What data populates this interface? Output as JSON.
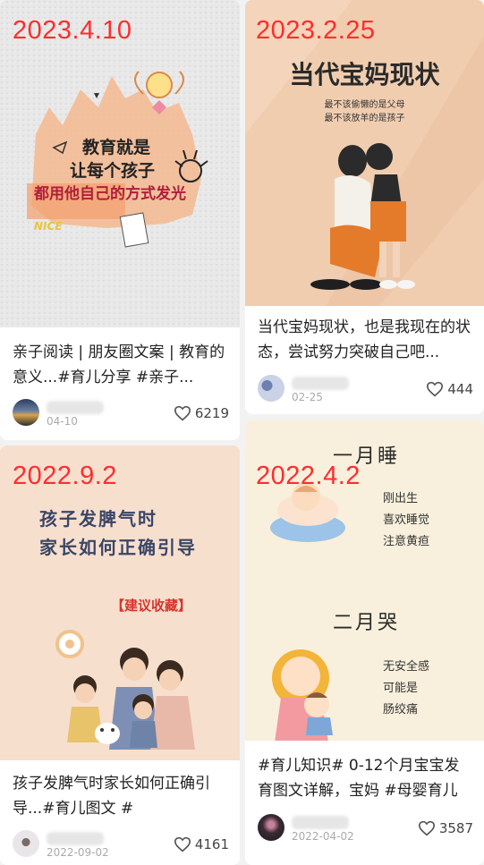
{
  "cards": [
    {
      "stamp": "2023.4.10",
      "title": "亲子阅读 | 朋友圈文案 | 教育的意义...#育儿分享 #亲子...",
      "date": "04-10",
      "likes": "6219",
      "poster": {
        "line1": "教育就是",
        "line2": "让每个孩子",
        "line3": "都用他自己的方式发光",
        "tag": "NICE"
      }
    },
    {
      "stamp": "2023.2.25",
      "title": "当代宝妈现状，也是我现在的状态，尝试努力突破自己吧...",
      "date": "02-25",
      "likes": "444",
      "poster": {
        "heading": "当代宝妈现状",
        "sub1": "最不该偷懒的是父母",
        "sub2": "最不该放羊的是孩子"
      }
    },
    {
      "stamp": "2022.9.2",
      "title": "孩子发脾气时家长如何正确引导...#育儿图文 #",
      "date": "2022-09-02",
      "likes": "4161",
      "poster": {
        "line1": "孩子发脾气时",
        "line2": "家长如何正确引导",
        "badge": "【建议收藏】"
      }
    },
    {
      "stamp": "2022.4.2",
      "title": "#育儿知识# 0-12个月宝宝发育图文详解，宝妈 #母婴育儿",
      "date": "2022-04-02",
      "likes": "3587",
      "poster": {
        "h1": "一月睡",
        "a1": "刚出生",
        "a2": "喜欢睡觉",
        "a3": "注意黄疸",
        "h2": "二月哭",
        "b1": "无安全感",
        "b2": "可能是",
        "b3": "肠绞痛"
      }
    }
  ]
}
